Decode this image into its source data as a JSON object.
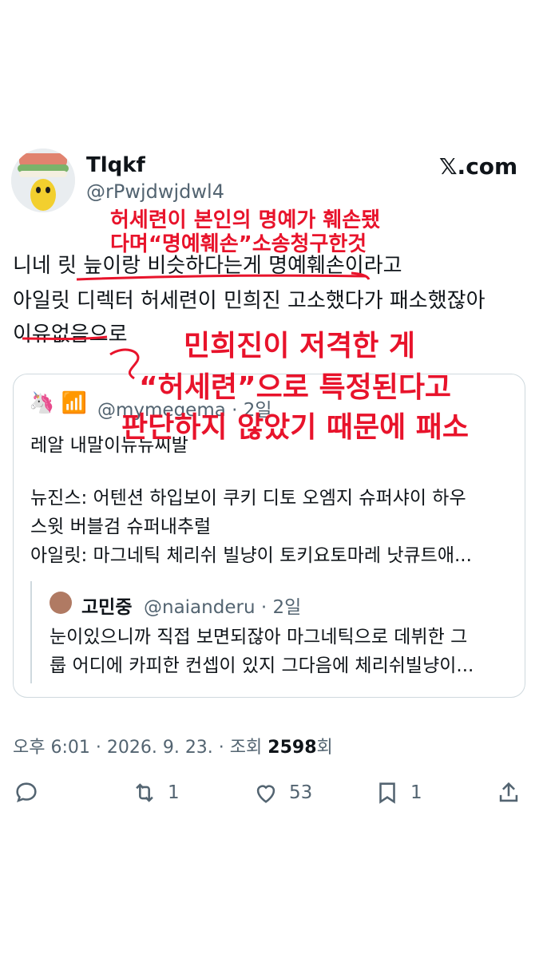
{
  "tweet": {
    "author_name": "Tlqkf",
    "author_handle": "@rPwjdwjdwl4",
    "brand": "𝕏.com",
    "lines": [
      "니네 릿 늪이랑 비슷하다는게 명예훼손이라고",
      "아일릿 디렉터 허세련이 민희진 고소했다가 패소했잖아",
      "이유없음으로"
    ],
    "timestamp": "오후 6:01 · 2026. 9. 23. · 조회 ",
    "views": "2598",
    "views_suffix": "회"
  },
  "quote": {
    "icons": "🦄 📶",
    "handle": "@mymegema · 2일",
    "lines": [
      "레알 내말이뉴뉴씨발",
      "뉴진스: 어텐션 하입보이 쿠키 디토 오엠지 슈퍼샤이 하우",
      "스윗 버블검 슈퍼내추럴",
      "아일릿: 마그네틱 체리쉬 빌냥이 토키요토마레 낫큐트애..."
    ]
  },
  "nested_quote": {
    "name": "고민중",
    "handle": "@naianderu · 2일",
    "lines": [
      "눈이있으니까 직접 보면되잖아 마그네틱으로 데뷔한 그",
      "룹 어디에 카피한 컨셉이 있지 그다음에 체리쉬빌냥이..."
    ]
  },
  "actions": {
    "reply_count": "",
    "retweet_count": "1",
    "like_count": "53",
    "bookmark_count": "1"
  },
  "annotations": {
    "top_line1": "허세련이 본인의 명예가 훼손됐",
    "top_line2": "다며“명예훼손”소송청구한것",
    "big_line1": "민희진이 저격한 게",
    "big_line2": "“허세련”으로 특정된다고",
    "big_line3": "판단하지 않았기 때문에 패소",
    "color": "#e8132b"
  }
}
